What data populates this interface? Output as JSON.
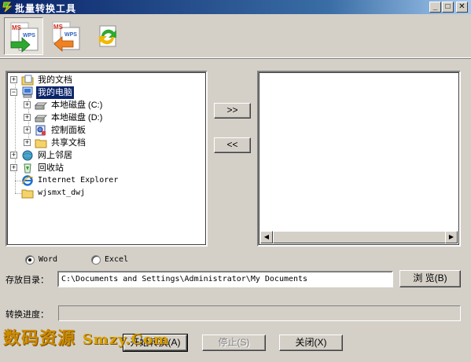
{
  "window": {
    "title": "批量转换工具",
    "minimize": "_",
    "maximize": "□",
    "close": "✕"
  },
  "toolbar": {
    "buttons": [
      {
        "name": "ms-to-wps",
        "top_text": "MS",
        "bottom_text": "WPS",
        "icon": "arrow-right-icon"
      },
      {
        "name": "wps-to-ms",
        "top_text": "MS",
        "bottom_text": "WPS",
        "icon": "arrow-left-icon"
      },
      {
        "name": "refresh",
        "icon": "refresh-icon"
      }
    ]
  },
  "tree": {
    "items": [
      {
        "label": "我的文档",
        "icon": "folder-docs-icon",
        "expander": "+"
      },
      {
        "label": "我的电脑",
        "icon": "computer-icon",
        "expander": "−",
        "selected": true
      },
      {
        "label": "本地磁盘 (C:)",
        "icon": "drive-icon",
        "expander": "+"
      },
      {
        "label": "本地磁盘 (D:)",
        "icon": "drive-icon",
        "expander": "+"
      },
      {
        "label": "控制面板",
        "icon": "control-panel-icon",
        "expander": "+"
      },
      {
        "label": "共享文档",
        "icon": "folder-icon",
        "expander": "+"
      },
      {
        "label": "网上邻居",
        "icon": "network-icon",
        "expander": "+"
      },
      {
        "label": "回收站",
        "icon": "recycle-bin-icon",
        "expander": "+"
      },
      {
        "label": "Internet Explorer",
        "icon": "ie-icon"
      },
      {
        "label": "wjsmxt_dwj",
        "icon": "folder-icon"
      }
    ]
  },
  "move_buttons": {
    "add": ">>",
    "remove": "<<"
  },
  "format": {
    "word": "Word",
    "excel": "Excel",
    "selected": "word"
  },
  "output": {
    "label": "存放目录：",
    "path": "C:\\Documents and Settings\\Administrator\\My Documents",
    "browse": "浏 览(B)"
  },
  "progress": {
    "label": "转换进度：",
    "value": 0
  },
  "actions": {
    "start": "开始转换(A)",
    "stop": "停止(S)",
    "close": "关闭(X)"
  },
  "watermark": {
    "cn": "数码资源",
    "en": "Smzy.Com"
  },
  "colors": {
    "selection": "#0a246a",
    "face": "#d4d0c8",
    "watermark": "#cc8a00"
  }
}
